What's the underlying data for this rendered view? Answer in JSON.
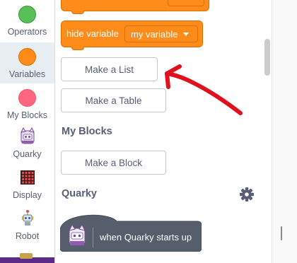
{
  "categories": [
    {
      "label": "Operators",
      "color": "#59c059",
      "border": "#389438"
    },
    {
      "label": "Variables",
      "color": "#ff8c1a",
      "border": "#db6e00"
    },
    {
      "label": "My Blocks",
      "color": "#ff6680",
      "border": "#ff4d6a"
    },
    {
      "label": "Quarky",
      "icon": "quarky-icon"
    },
    {
      "label": "Display",
      "icon": "display-grid-icon"
    },
    {
      "label": "Robot",
      "icon": "robot-icon"
    }
  ],
  "selected_category": "Variables",
  "palette": {
    "hide_variable_block": {
      "text": "hide variable",
      "dropdown": "my variable"
    },
    "make_list_button": "Make a List",
    "make_table_button": "Make a Table",
    "my_blocks_title": "My Blocks",
    "make_block_button": "Make a Block",
    "quarky_title": "Quarky",
    "hat_block_text": "when Quarky starts up"
  },
  "colors": {
    "variables_orange": "#ff8c1a",
    "hat_block_gray": "#575e6b",
    "annotation_red": "#e0101e"
  }
}
